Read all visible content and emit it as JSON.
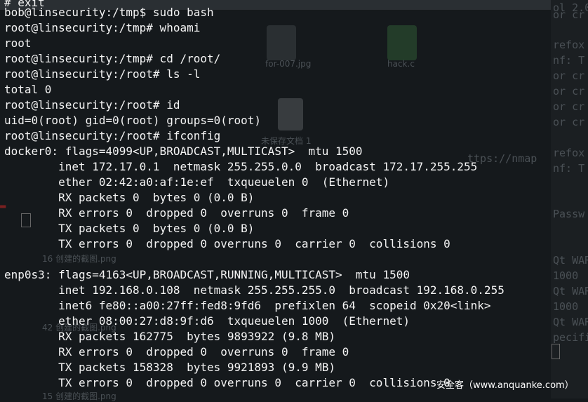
{
  "terminal": {
    "lines": [
      "# exit",
      "bob@linsecurity:/tmp$ sudo bash",
      "root@linsecurity:/tmp# whoami",
      "root",
      "root@linsecurity:/tmp# cd /root/",
      "root@linsecurity:/root# ls -l",
      "total 0",
      "root@linsecurity:/root# id",
      "uid=0(root) gid=0(root) groups=0(root)",
      "root@linsecurity:/root# ifconfig",
      "docker0: flags=4099<UP,BROADCAST,MULTICAST>  mtu 1500",
      "        inet 172.17.0.1  netmask 255.255.0.0  broadcast 172.17.255.255",
      "        ether 02:42:a0:af:1e:ef  txqueuelen 0  (Ethernet)",
      "        RX packets 0  bytes 0 (0.0 B)",
      "        RX errors 0  dropped 0  overruns 0  frame 0",
      "        TX packets 0  bytes 0 (0.0 B)",
      "        TX errors 0  dropped 0 overruns 0  carrier 0  collisions 0",
      "",
      "enp0s3: flags=4163<UP,BROADCAST,RUNNING,MULTICAST>  mtu 1500",
      "        inet 192.168.0.108  netmask 255.255.255.0  broadcast 192.168.0.255",
      "        inet6 fe80::a00:27ff:fed8:9fd6  prefixlen 64  scopeid 0x20<link>",
      "        ether 08:00:27:d8:9f:d6  txqueuelen 1000  (Ethernet)",
      "        RX packets 162775  bytes 9893922 (9.8 MB)",
      "        RX errors 0  dropped 0  overruns 0  frame 0",
      "        TX packets 158328  bytes 9921893 (9.9 MB)",
      "        TX errors 0  dropped 0 overruns 0  carrier 0  collisions 0"
    ]
  },
  "background": {
    "files": [
      {
        "label": "for-007.jpg"
      },
      {
        "label": "hack.c"
      },
      {
        "label": "未保存文档 1"
      },
      {
        "label": "16 创建的截图.png"
      },
      {
        "label": "42 创建的截图.png"
      },
      {
        "label": "15 创建的截图.png"
      }
    ],
    "side_text": [
      "ol 2.0)",
      "or cr",
      "refox",
      "nf: T",
      "or cr",
      "or cr",
      "or cr",
      "or cr",
      "refox",
      "nf: T",
      "Passw",
      "Qt WAR",
      " 1000",
      "Qt WAR",
      " 1000",
      "Qt WAR",
      "pecifi"
    ],
    "nmap_fragment": "ttps://nmap"
  },
  "watermark": {
    "text": "安全客（www.anquanke.com）"
  }
}
